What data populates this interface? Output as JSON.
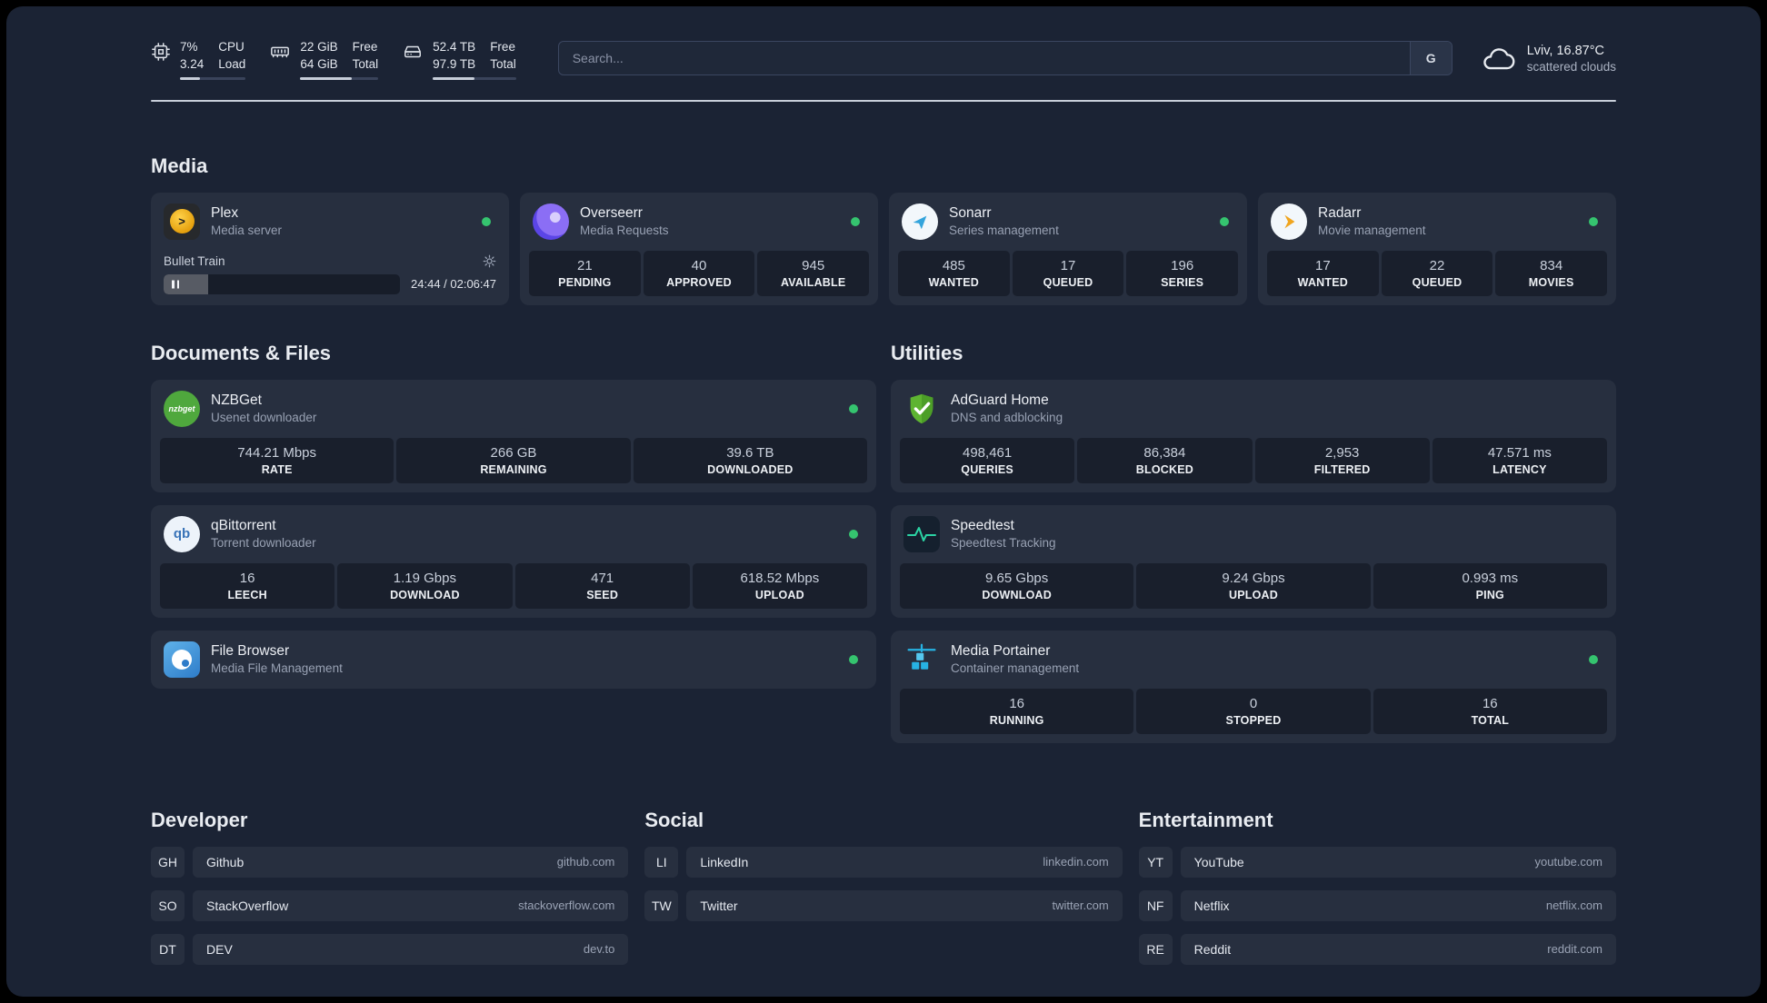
{
  "topbar": {
    "cpu": {
      "value1": "7%",
      "value2": "3.24",
      "label1": "CPU",
      "label2": "Load"
    },
    "memory": {
      "value1": "22 GiB",
      "value2": "64 GiB",
      "label1": "Free",
      "label2": "Total"
    },
    "disk": {
      "value1": "52.4 TB",
      "value2": "97.9 TB",
      "label1": "Free",
      "label2": "Total"
    },
    "search": {
      "placeholder": "Search...",
      "provider": "G"
    },
    "weather": {
      "location": "Lviv, 16.87°C",
      "condition": "scattered clouds"
    }
  },
  "groups": {
    "media": {
      "title": "Media",
      "services": [
        {
          "name": "Plex",
          "description": "Media server",
          "player": {
            "track": "Bullet Train",
            "time": "24:44 / 02:06:47"
          }
        },
        {
          "name": "Overseerr",
          "description": "Media Requests",
          "stats": [
            {
              "value": "21",
              "label": "PENDING"
            },
            {
              "value": "40",
              "label": "APPROVED"
            },
            {
              "value": "945",
              "label": "AVAILABLE"
            }
          ]
        },
        {
          "name": "Sonarr",
          "description": "Series management",
          "stats": [
            {
              "value": "485",
              "label": "WANTED"
            },
            {
              "value": "17",
              "label": "QUEUED"
            },
            {
              "value": "196",
              "label": "SERIES"
            }
          ]
        },
        {
          "name": "Radarr",
          "description": "Movie management",
          "stats": [
            {
              "value": "17",
              "label": "WANTED"
            },
            {
              "value": "22",
              "label": "QUEUED"
            },
            {
              "value": "834",
              "label": "MOVIES"
            }
          ]
        }
      ]
    },
    "documents": {
      "title": "Documents & Files",
      "services": [
        {
          "name": "NZBGet",
          "description": "Usenet downloader",
          "stats": [
            {
              "value": "744.21 Mbps",
              "label": "RATE"
            },
            {
              "value": "266 GB",
              "label": "REMAINING"
            },
            {
              "value": "39.6 TB",
              "label": "DOWNLOADED"
            }
          ]
        },
        {
          "name": "qBittorrent",
          "description": "Torrent downloader",
          "stats": [
            {
              "value": "16",
              "label": "LEECH"
            },
            {
              "value": "1.19 Gbps",
              "label": "DOWNLOAD"
            },
            {
              "value": "471",
              "label": "SEED"
            },
            {
              "value": "618.52 Mbps",
              "label": "UPLOAD"
            }
          ]
        },
        {
          "name": "File Browser",
          "description": "Media File Management",
          "stats": []
        }
      ]
    },
    "utilities": {
      "title": "Utilities",
      "services": [
        {
          "name": "AdGuard Home",
          "description": "DNS and adblocking",
          "stats": [
            {
              "value": "498,461",
              "label": "QUERIES"
            },
            {
              "value": "86,384",
              "label": "BLOCKED"
            },
            {
              "value": "2,953",
              "label": "FILTERED"
            },
            {
              "value": "47.571 ms",
              "label": "LATENCY"
            }
          ]
        },
        {
          "name": "Speedtest",
          "description": "Speedtest Tracking",
          "stats": [
            {
              "value": "9.65 Gbps",
              "label": "DOWNLOAD"
            },
            {
              "value": "9.24 Gbps",
              "label": "UPLOAD"
            },
            {
              "value": "0.993 ms",
              "label": "PING"
            }
          ]
        },
        {
          "name": "Media Portainer",
          "description": "Container management",
          "stats": [
            {
              "value": "16",
              "label": "RUNNING"
            },
            {
              "value": "0",
              "label": "STOPPED"
            },
            {
              "value": "16",
              "label": "TOTAL"
            }
          ]
        }
      ]
    }
  },
  "bookmarks": [
    {
      "title": "Developer",
      "items": [
        {
          "abbr": "GH",
          "name": "Github",
          "domain": "github.com"
        },
        {
          "abbr": "SO",
          "name": "StackOverflow",
          "domain": "stackoverflow.com"
        },
        {
          "abbr": "DT",
          "name": "DEV",
          "domain": "dev.to"
        }
      ]
    },
    {
      "title": "Social",
      "items": [
        {
          "abbr": "LI",
          "name": "LinkedIn",
          "domain": "linkedin.com"
        },
        {
          "abbr": "TW",
          "name": "Twitter",
          "domain": "twitter.com"
        }
      ]
    },
    {
      "title": "Entertainment",
      "items": [
        {
          "abbr": "YT",
          "name": "YouTube",
          "domain": "youtube.com"
        },
        {
          "abbr": "NF",
          "name": "Netflix",
          "domain": "netflix.com"
        },
        {
          "abbr": "RE",
          "name": "Reddit",
          "domain": "reddit.com"
        }
      ]
    }
  ],
  "icons": {
    "plex_glyph": ">",
    "nzbget_text": "nzbget",
    "qbittorrent_text": "qb"
  },
  "colors": {
    "status_online": "#35c46f",
    "accent": "#27b2e3"
  }
}
